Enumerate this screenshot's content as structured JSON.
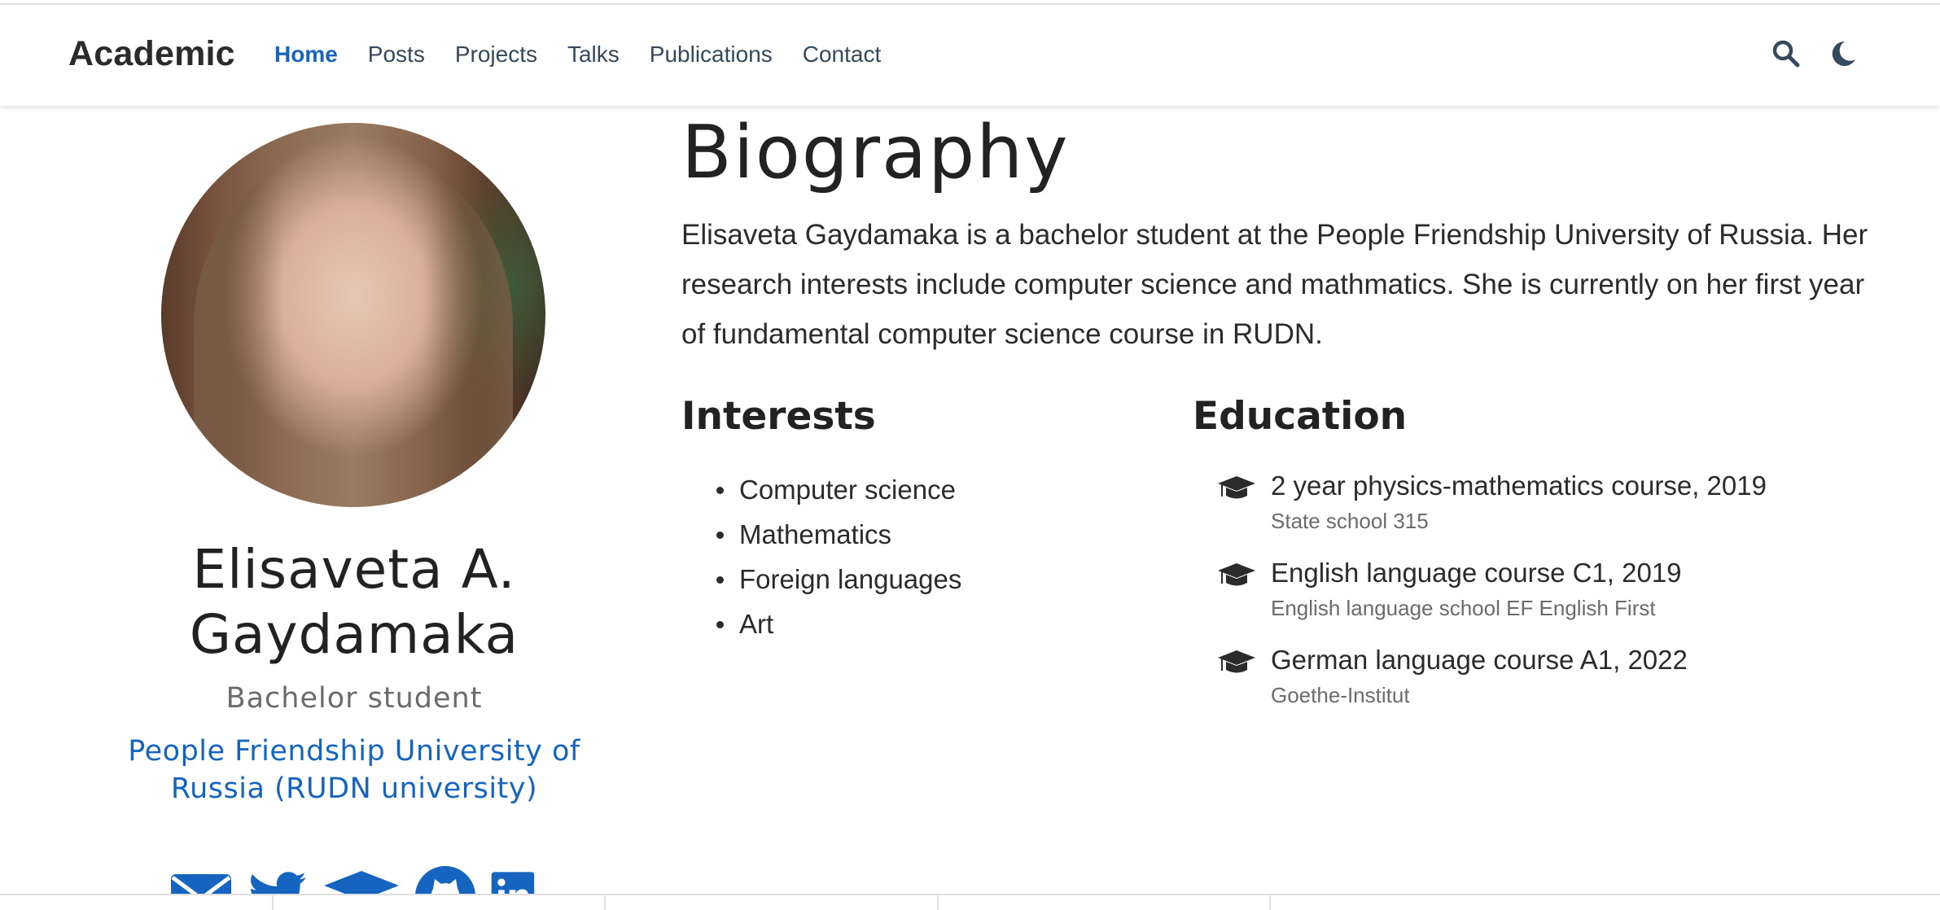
{
  "navbar": {
    "brand": "Academic",
    "links": [
      {
        "label": "Home",
        "active": true
      },
      {
        "label": "Posts",
        "active": false
      },
      {
        "label": "Projects",
        "active": false
      },
      {
        "label": "Talks",
        "active": false
      },
      {
        "label": "Publications",
        "active": false
      },
      {
        "label": "Contact",
        "active": false
      }
    ],
    "icons": [
      "search-icon",
      "moon-icon"
    ]
  },
  "profile": {
    "name": "Elisaveta A. Gaydamaka",
    "role": "Bachelor student",
    "organization": "People Friendship University of Russia (RUDN university)",
    "socials": [
      "envelope-icon",
      "twitter-icon",
      "graduation-cap-icon",
      "github-icon",
      "linkedin-icon"
    ]
  },
  "biography": {
    "title": "Biography",
    "text": "Elisaveta Gaydamaka is a bachelor student at the People Friendship University of Russia. Her research interests include computer science and mathmatics. She is currently on her first year of fundamental computer science course in RUDN."
  },
  "interests": {
    "title": "Interests",
    "items": [
      "Computer science",
      "Mathematics",
      "Foreign languages",
      "Art"
    ]
  },
  "education": {
    "title": "Education",
    "items": [
      {
        "course": "2 year physics-mathematics course, 2019",
        "school": "State school 315"
      },
      {
        "course": "English language course C1, 2019",
        "school": "English language school EF English First"
      },
      {
        "course": "German language course A1, 2022",
        "school": "Goethe-Institut"
      }
    ]
  },
  "colors": {
    "accent": "#1565c0",
    "text": "#2b2b2b",
    "muted": "#6b6b6b"
  }
}
